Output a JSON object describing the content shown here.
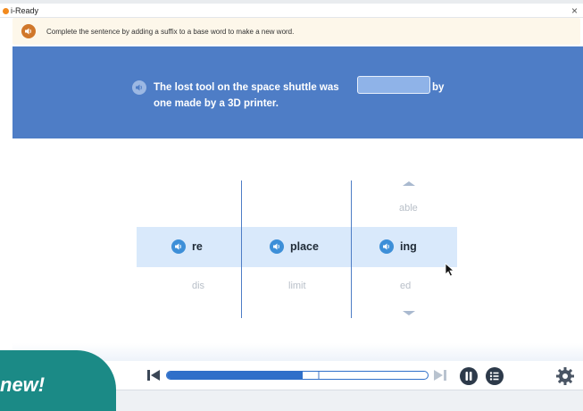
{
  "app": {
    "name": "i-Ready"
  },
  "instruction": {
    "text": "Complete the sentence by adding a suffix to a base word to make a new word."
  },
  "question": {
    "line1": "The lost tool on the space shuttle was",
    "after_blank": "by",
    "line2": "one made by a 3D printer.",
    "answer_value": ""
  },
  "wheels": {
    "prefix": {
      "selected": "re",
      "below": "dis"
    },
    "base": {
      "selected": "place",
      "below": "limit"
    },
    "suffix": {
      "above": "able",
      "selected": "ing",
      "below": "ed"
    }
  },
  "player": {
    "progress": 0.52,
    "marker": 0.58
  },
  "badge": {
    "text": "new!"
  },
  "colors": {
    "question_bg": "#4e7dc6",
    "accent": "#2f6fc9",
    "audio": "#3d8fd8",
    "badge": "#1b8a86"
  },
  "icons": [
    "audio-icon",
    "close-icon",
    "skip-back-icon",
    "skip-forward-icon",
    "pause-icon",
    "list-icon",
    "gear-icon",
    "mouse-cursor-icon"
  ]
}
